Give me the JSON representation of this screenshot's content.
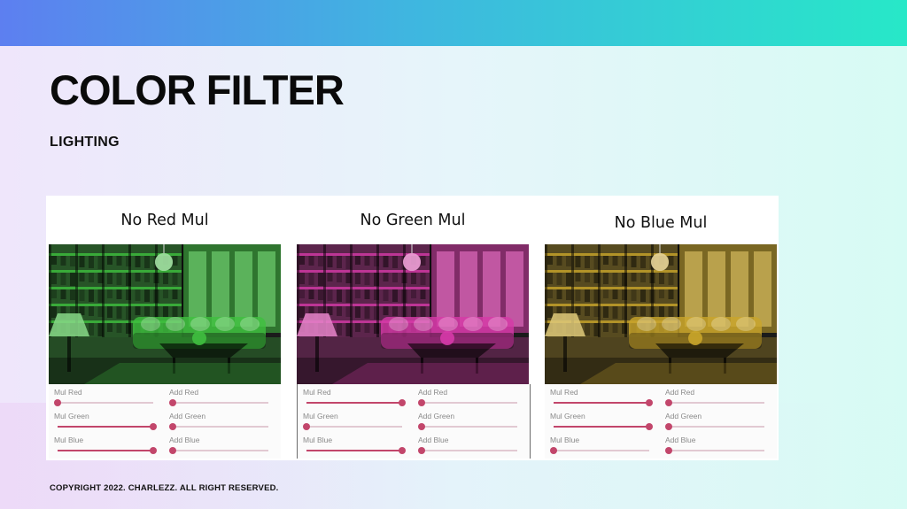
{
  "slide": {
    "title": "COLOR FILTER",
    "subtitle": "LIGHTING",
    "footer": "COPYRIGHT 2022. CHARLEZZ. ALL RIGHT RESERVED."
  },
  "panels": [
    {
      "title": "No Red Mul",
      "tint": "#3fbf3f",
      "controls": [
        {
          "label": "Mul Red",
          "value": 0.0
        },
        {
          "label": "Add Red",
          "value": 0.0
        },
        {
          "label": "Mul Green",
          "value": 1.0
        },
        {
          "label": "Add Green",
          "value": 0.0
        },
        {
          "label": "Mul Blue",
          "value": 1.0
        },
        {
          "label": "Add Blue",
          "value": 0.0
        }
      ]
    },
    {
      "title": "No Green Mul",
      "tint": "#d63aa8",
      "controls": [
        {
          "label": "Mul Red",
          "value": 1.0
        },
        {
          "label": "Add Red",
          "value": 0.0
        },
        {
          "label": "Mul Green",
          "value": 0.0
        },
        {
          "label": "Add Green",
          "value": 0.0
        },
        {
          "label": "Mul Blue",
          "value": 1.0
        },
        {
          "label": "Add Blue",
          "value": 0.0
        }
      ]
    },
    {
      "title": "No Blue Mul",
      "tint": "#c9a52a",
      "controls": [
        {
          "label": "Mul Red",
          "value": 1.0
        },
        {
          "label": "Add Red",
          "value": 0.0
        },
        {
          "label": "Mul Green",
          "value": 1.0
        },
        {
          "label": "Add Green",
          "value": 0.0
        },
        {
          "label": "Mul Blue",
          "value": 0.0
        },
        {
          "label": "Add Blue",
          "value": 0.0
        }
      ]
    }
  ],
  "colors": {
    "slider_accent": "#c2466b",
    "header_gradient_start": "#5d7ff0",
    "header_gradient_end": "#27e8c8"
  }
}
